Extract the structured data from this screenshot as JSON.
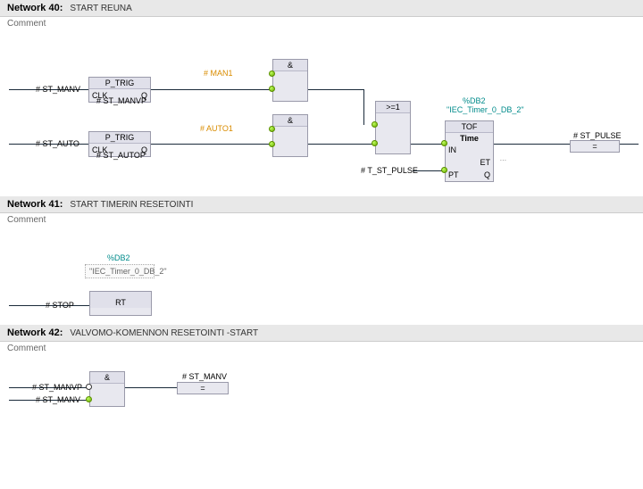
{
  "networks": [
    {
      "id": "n40",
      "number": "Network 40:",
      "title": "START REUNA",
      "comment": "Comment",
      "labels": {
        "st_manv": "# ST_MANV",
        "st_manvp": "# ST_MANVP",
        "st_auto": "# ST_AUTO",
        "st_autop": "# ST_AUTOP",
        "man1": "# MAN1",
        "auto1": "# AUTO1",
        "t_st_pulse": "# T_ST_PULSE",
        "db": "%DB2",
        "db_name": "\"IEC_Timer_0_DB_2\"",
        "st_pulse": "# ST_PULSE",
        "dots": "..."
      },
      "blocks": {
        "ptrig": "P_TRIG",
        "clk": "CLK",
        "q": "Q",
        "and": "&",
        "or": ">=1",
        "tof": "TOF",
        "time": "Time",
        "in": "IN",
        "pt": "PT",
        "et": "ET",
        "assign": "="
      }
    },
    {
      "id": "n41",
      "number": "Network 41:",
      "title": "START TIMERIN RESETOINTI",
      "comment": "Comment",
      "labels": {
        "db": "%DB2",
        "db_name": "\"IEC_Timer_0_DB_2\"",
        "stop": "# STOP"
      },
      "blocks": {
        "rt": "RT"
      }
    },
    {
      "id": "n42",
      "number": "Network 42:",
      "title": "VALVOMO-KOMENNON RESETOINTI -START",
      "comment": "Comment",
      "labels": {
        "st_manvp": "# ST_MANVP",
        "st_manv_in": "# ST_MANV",
        "st_manv_out": "# ST_MANV"
      },
      "blocks": {
        "and": "&",
        "assign": "="
      }
    }
  ]
}
